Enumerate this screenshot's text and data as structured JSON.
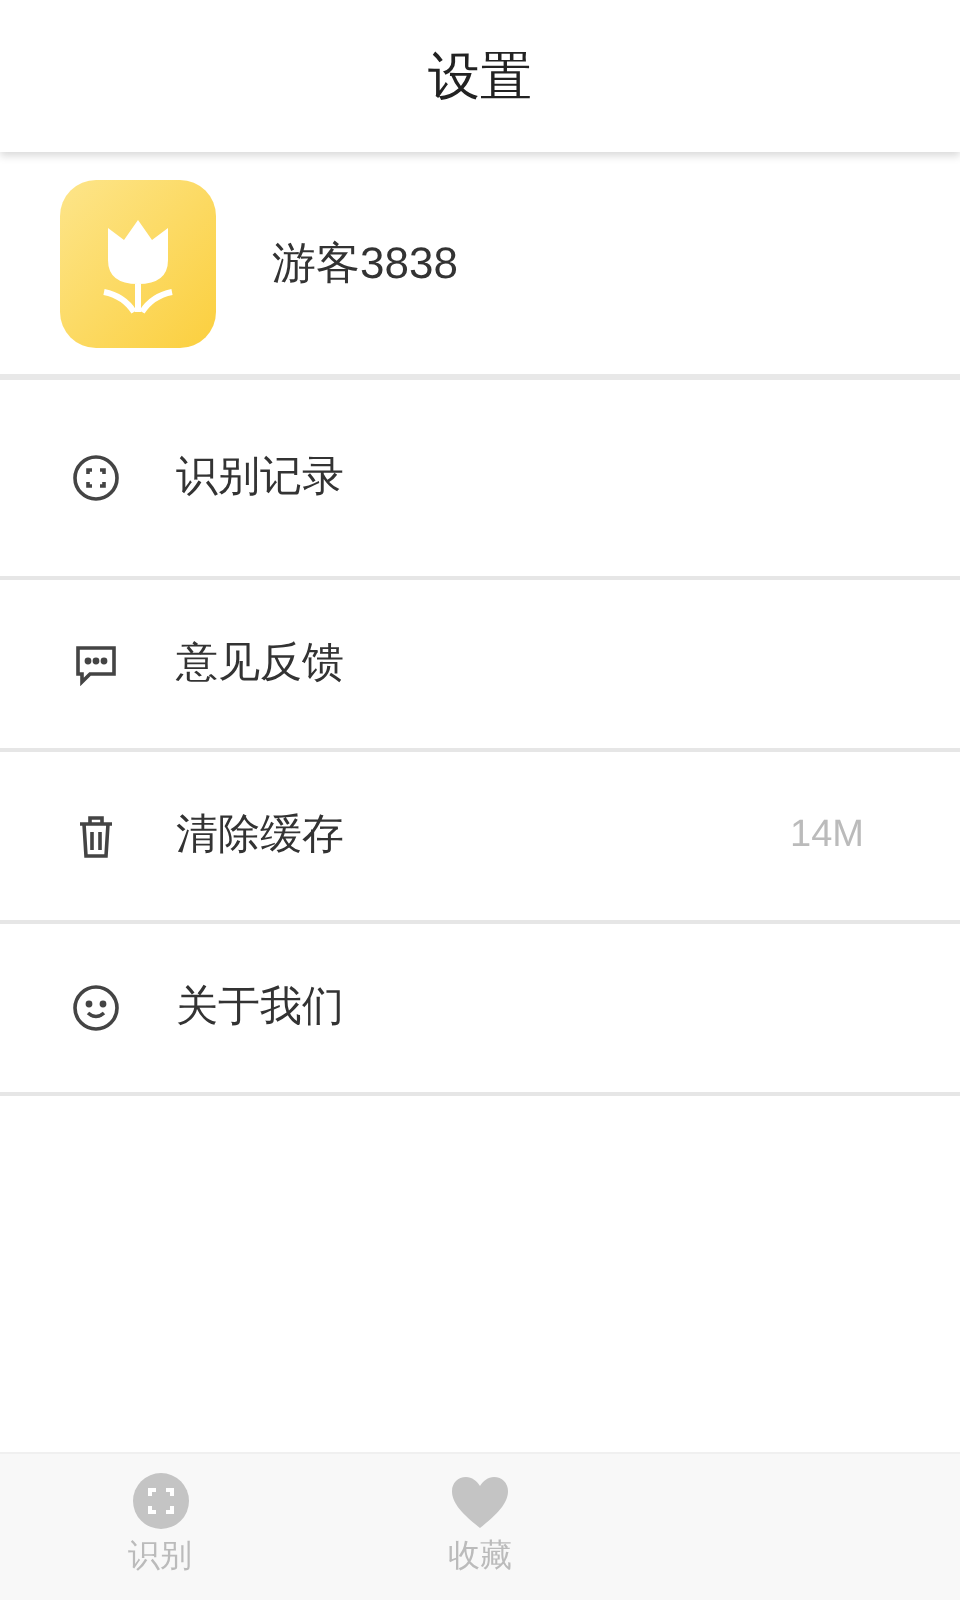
{
  "header": {
    "title": "设置"
  },
  "profile": {
    "name": "游客3838"
  },
  "menu": [
    {
      "kind": "scan",
      "label": "识别记录"
    },
    {
      "kind": "chat",
      "label": "意见反馈"
    },
    {
      "kind": "trash",
      "label": "清除缓存",
      "value": "14M"
    },
    {
      "kind": "smile",
      "label": "关于我们"
    }
  ],
  "tab_bar": [
    {
      "kind": "scan",
      "label": "识别",
      "selected": false
    },
    {
      "kind": "heart",
      "label": "收藏",
      "selected": false
    }
  ]
}
